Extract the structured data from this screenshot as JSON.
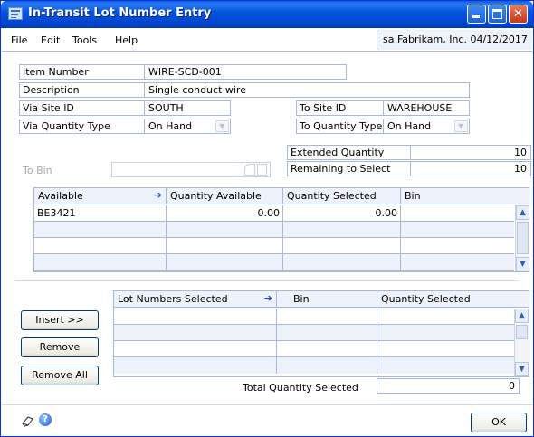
{
  "window": {
    "title": "In-Transit Lot Number Entry"
  },
  "menu": {
    "file": "File",
    "edit": "Edit",
    "tools": "Tools",
    "help": "Help",
    "company": "sa  Fabrikam, Inc. 04/12/2017"
  },
  "form": {
    "item_number_label": "Item Number",
    "item_number": "WIRE-SCD-001",
    "description_label": "Description",
    "description": "Single conduct wire",
    "via_site_label": "Via Site ID",
    "via_site": "SOUTH",
    "to_site_label": "To Site ID",
    "to_site": "WAREHOUSE",
    "via_qty_type_label": "Via Quantity Type",
    "via_qty_type": "On Hand",
    "to_qty_type_label": "To Quantity Type",
    "to_qty_type": "On Hand",
    "extended_qty_label": "Extended Quantity",
    "extended_qty": "10",
    "remaining_label": "Remaining to Select",
    "remaining": "10",
    "to_bin_label": "To Bin"
  },
  "available_grid": {
    "columns": [
      "Available",
      "Quantity Available",
      "Quantity Selected",
      "Bin"
    ],
    "rows": [
      [
        "BE3421",
        "0.00",
        "0.00",
        ""
      ],
      [
        "",
        "",
        "",
        ""
      ],
      [
        "",
        "",
        "",
        ""
      ],
      [
        "",
        "",
        "",
        ""
      ]
    ]
  },
  "selected_grid": {
    "columns": [
      "Lot Numbers Selected",
      "Bin",
      "Quantity Selected"
    ],
    "rows": [
      [
        "",
        "",
        ""
      ],
      [
        "",
        "",
        ""
      ],
      [
        "",
        "",
        ""
      ],
      [
        "",
        "",
        ""
      ]
    ],
    "total_label": "Total Quantity Selected",
    "total": "0"
  },
  "buttons": {
    "insert": "Insert >>",
    "remove": "Remove",
    "remove_all": "Remove All",
    "ok": "OK"
  }
}
